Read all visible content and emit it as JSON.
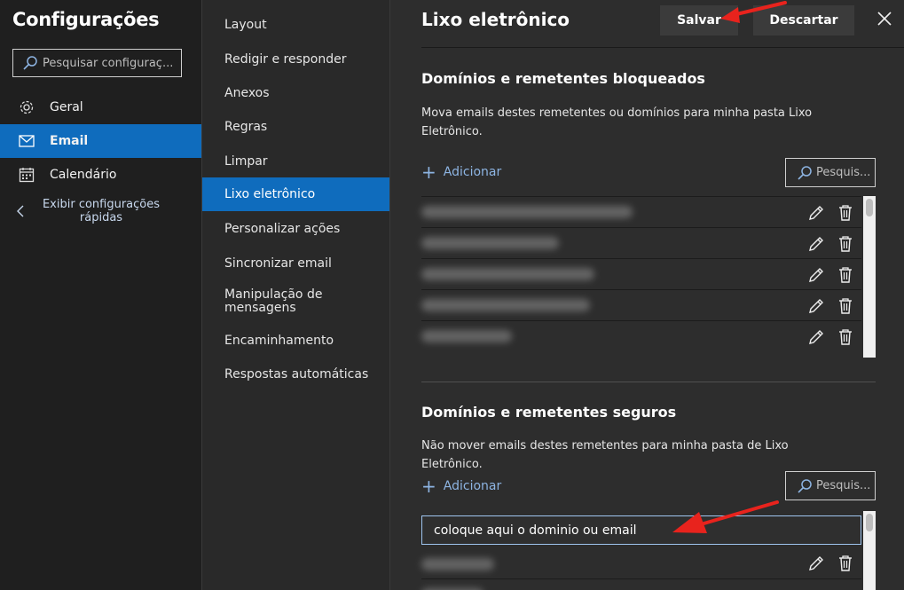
{
  "sidebar": {
    "title": "Configurações",
    "search_placeholder": "Pesquisar configuraç...",
    "items": [
      {
        "label": "Geral",
        "icon": "gear-icon"
      },
      {
        "label": "Email",
        "icon": "mail-icon"
      },
      {
        "label": "Calendário",
        "icon": "calendar-icon"
      }
    ],
    "quick_settings": "Exibir configurações rápidas"
  },
  "submenu": {
    "items": [
      "Layout",
      "Redigir e responder",
      "Anexos",
      "Regras",
      "Limpar",
      "Lixo eletrônico",
      "Personalizar ações",
      "Sincronizar email",
      "Manipulação de mensagens",
      "Encaminhamento",
      "Respostas automáticas"
    ],
    "active_index": 5
  },
  "pane": {
    "title": "Lixo eletrônico",
    "save_label": "Salvar",
    "discard_label": "Descartar",
    "blocked": {
      "title": "Domínios e remetentes bloqueados",
      "description": "Mova emails destes remetentes ou domínios para minha pasta Lixo Eletrônico.",
      "add_label": "Adicionar",
      "search_label": "Pesquis..."
    },
    "safe": {
      "title": "Domínios e remetentes seguros",
      "description": "Não mover emails destes remetentes para minha pasta de Lixo Eletrônico.",
      "add_label": "Adicionar",
      "search_label": "Pesquis...",
      "input_value": "coloque aqui o dominio ou email"
    }
  },
  "colors": {
    "accent": "#0f6cbd",
    "link": "#8db4e2",
    "annotation_arrow": "#e8231d"
  }
}
